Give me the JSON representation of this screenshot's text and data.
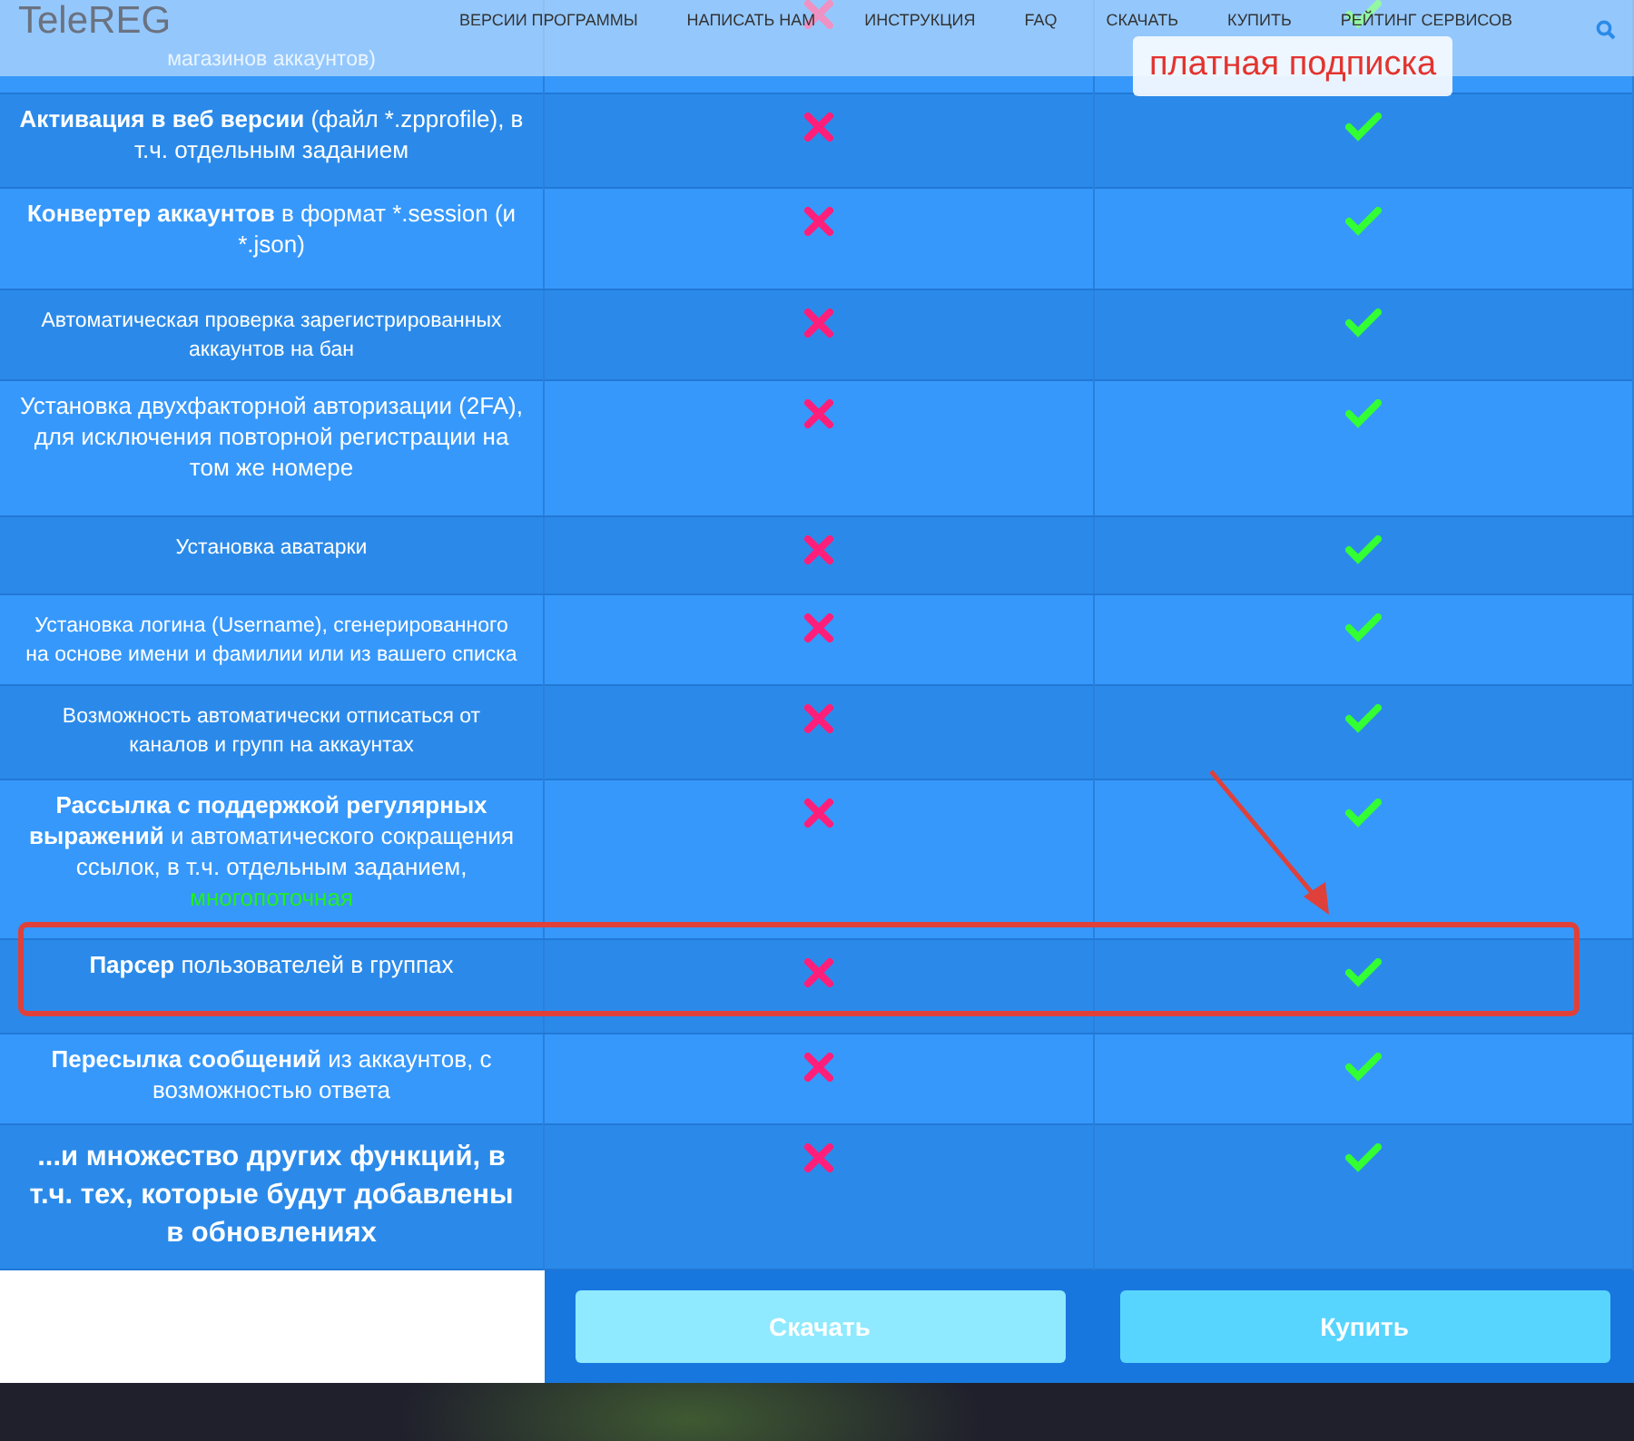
{
  "navbar": {
    "logo": "TeleREG",
    "links": [
      "ВЕРСИИ ПРОГРАММЫ",
      "НАПИСАТЬ НАМ",
      "ИНСТРУКЦИЯ",
      "FAQ",
      "СКАЧАТЬ",
      "КУПИТЬ",
      "РЕЙТИНГ СЕРВИСОВ"
    ]
  },
  "rows": [
    {
      "kind": "small",
      "text": "магазинов аккаунтов)",
      "free": false,
      "paid": true,
      "annotated": false
    },
    {
      "kind": "normal",
      "text": "**Активация в веб версии** (файл *.zpprofile), в т.ч. отдельным заданием",
      "free": false,
      "paid": true,
      "annotated": false
    },
    {
      "kind": "normal",
      "text": "**Конвертер аккаунтов** в формат *.session (и *.json)",
      "free": false,
      "paid": true,
      "annotated": false
    },
    {
      "kind": "small",
      "text": "Автоматическая проверка зарегистрированных аккаунтов на бан",
      "free": false,
      "paid": true,
      "annotated": false
    },
    {
      "kind": "normal",
      "text": "Установка двухфакторной авторизации (2FA), для исключения повторной регистрации на том же номере",
      "free": false,
      "paid": true,
      "annotated": false
    },
    {
      "kind": "small",
      "text": "Установка аватарки",
      "free": false,
      "paid": true,
      "annotated": false
    },
    {
      "kind": "small",
      "text": "Установка логина (Username), сгенерированного на основе имени и фамилии или из вашего списка",
      "free": false,
      "paid": true,
      "annotated": false
    },
    {
      "kind": "small",
      "text": "Возможность автоматически отписаться от каналов и групп на аккаунтах",
      "free": false,
      "paid": true,
      "annotated": false
    },
    {
      "kind": "normal",
      "text": "**Рассылка с поддержкой регулярных выражений** и автоматического сокращения ссылок, в т.ч. отдельным заданием,",
      "extra": "многопоточная",
      "free": false,
      "paid": true,
      "annotated": false
    },
    {
      "kind": "normal",
      "text": "**Парсер** пользователей в группах",
      "free": false,
      "paid": true,
      "annotated": true
    },
    {
      "kind": "normal",
      "text": "**Пересылка сообщений** из аккаунтов, с возможностью ответа",
      "free": false,
      "paid": true,
      "annotated": false
    },
    {
      "kind": "large",
      "text": "...и множество других функций, в т.ч. тех, которые будут добавлены в обновлениях",
      "free": false,
      "paid": true,
      "annotated": false
    }
  ],
  "buttons": [
    "Скачать",
    "Купить"
  ],
  "callout": "платная подписка"
}
